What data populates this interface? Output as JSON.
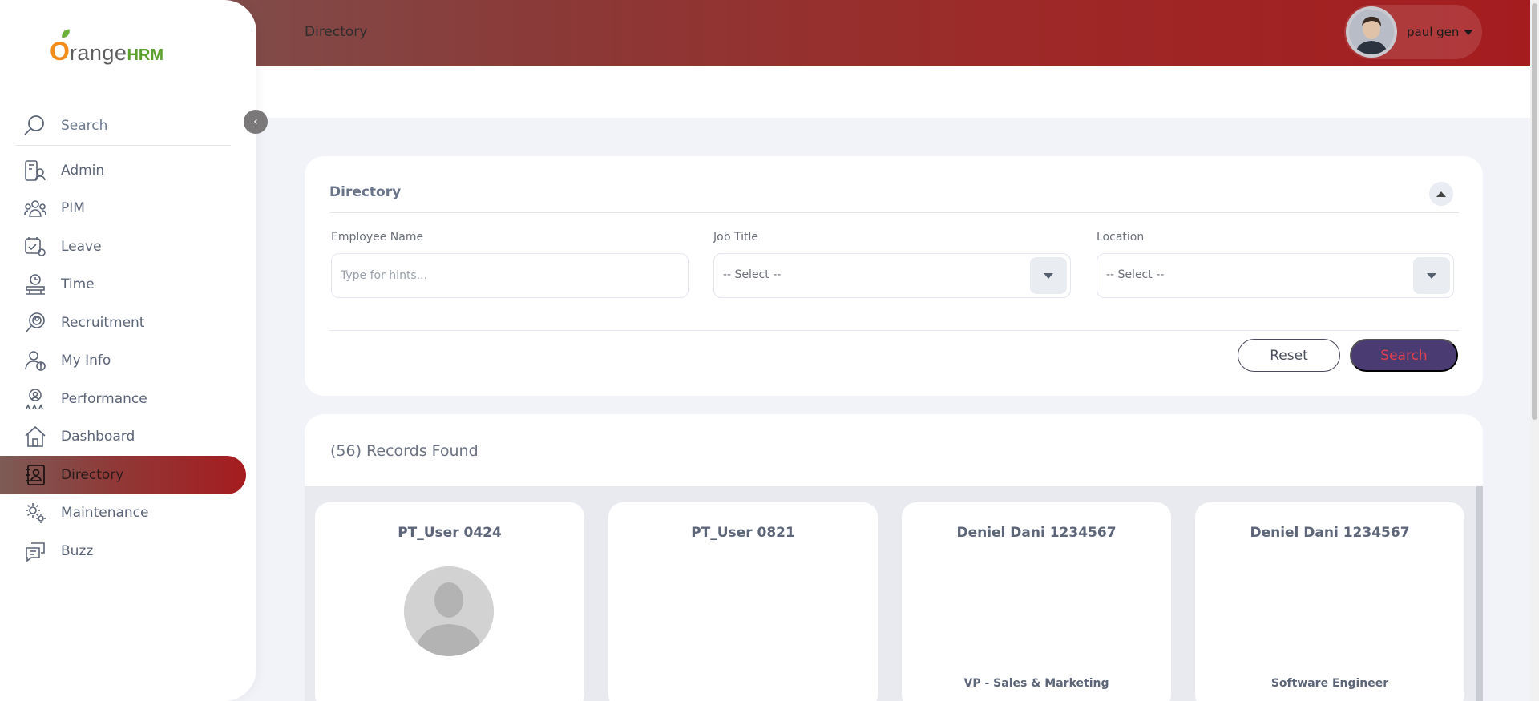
{
  "app": {
    "logo_text": "OrangeHRM"
  },
  "header": {
    "title": "Directory",
    "user_name": "paul gen"
  },
  "sidebar": {
    "search_label": "Search",
    "items": [
      {
        "label": "Admin",
        "icon": "admin-icon",
        "active": false
      },
      {
        "label": "PIM",
        "icon": "pim-icon",
        "active": false
      },
      {
        "label": "Leave",
        "icon": "leave-icon",
        "active": false
      },
      {
        "label": "Time",
        "icon": "time-icon",
        "active": false
      },
      {
        "label": "Recruitment",
        "icon": "recruitment-icon",
        "active": false
      },
      {
        "label": "My Info",
        "icon": "my-info-icon",
        "active": false
      },
      {
        "label": "Performance",
        "icon": "performance-icon",
        "active": false
      },
      {
        "label": "Dashboard",
        "icon": "dashboard-icon",
        "active": false
      },
      {
        "label": "Directory",
        "icon": "directory-icon",
        "active": true
      },
      {
        "label": "Maintenance",
        "icon": "maintenance-icon",
        "active": false
      },
      {
        "label": "Buzz",
        "icon": "buzz-icon",
        "active": false
      }
    ]
  },
  "filter": {
    "title": "Directory",
    "employee_name_label": "Employee Name",
    "employee_name_placeholder": "Type for hints...",
    "employee_name_value": "",
    "job_title_label": "Job Title",
    "job_title_value": "-- Select --",
    "location_label": "Location",
    "location_value": "-- Select --",
    "reset_label": "Reset",
    "search_label": "Search"
  },
  "results": {
    "count_text": "(56) Records Found",
    "employees": [
      {
        "name": "PT_User 0424",
        "job_title": "",
        "has_photo": true
      },
      {
        "name": "PT_User 0821",
        "job_title": "",
        "has_photo": false
      },
      {
        "name": "Deniel Dani 1234567",
        "job_title": "VP - Sales & Marketing",
        "has_photo": false
      },
      {
        "name": "Deniel Dani 1234567",
        "job_title": "Software Engineer",
        "has_photo": false
      }
    ]
  },
  "colors": {
    "brand_gradient_start": "#7a5a56",
    "brand_gradient_end": "#a51c1f",
    "search_button_bg": "#4a3b73",
    "search_button_text": "#e2404a"
  }
}
